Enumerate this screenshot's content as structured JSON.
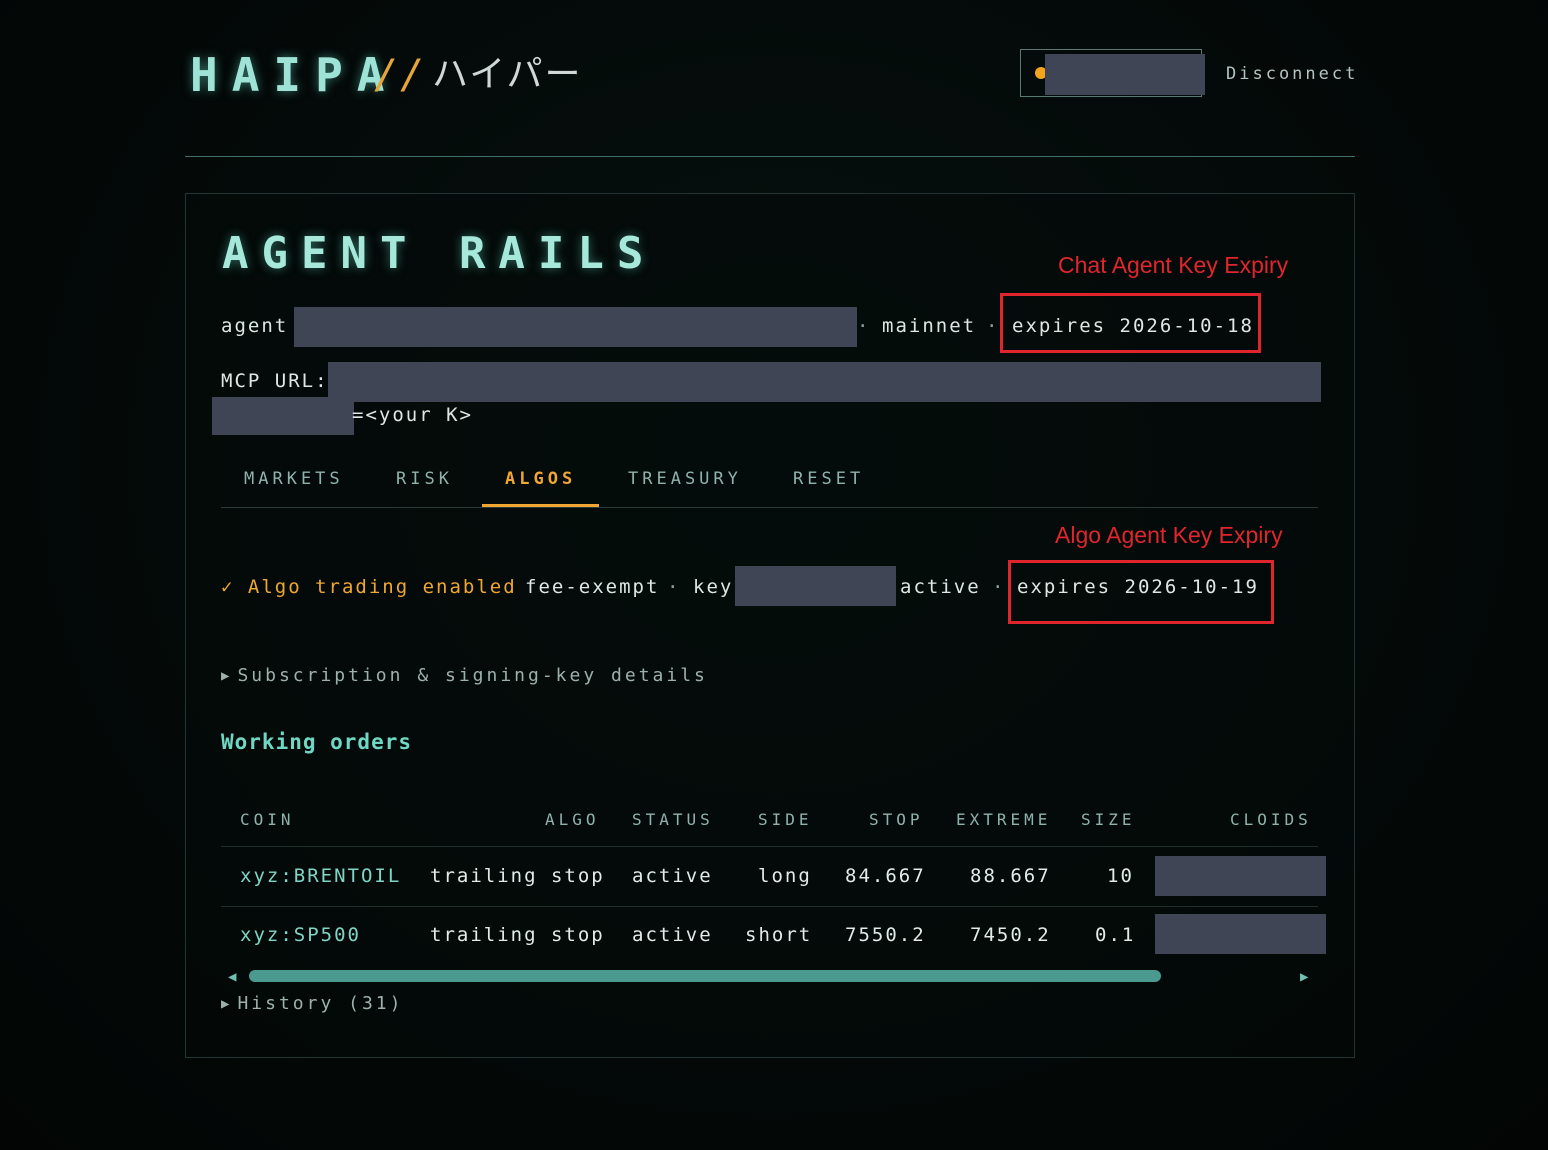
{
  "header": {
    "brand": "HAIPA",
    "separator": "//",
    "brand_jp": "ハイパー",
    "disconnect_label": "Disconnect"
  },
  "panel": {
    "title": "AGENT RAILS",
    "agent_label": "agent",
    "network_sep": "·",
    "network": "mainnet",
    "expiry_sep": "·",
    "agent_expiry": "expires 2026-10-18",
    "mcp_label": "MCP URL:",
    "mcp_suffix": "=<your K>",
    "annotations": {
      "chat": "Chat Agent Key Expiry",
      "algo": "Algo Agent Key Expiry"
    }
  },
  "tabs": [
    {
      "label": "MARKETS"
    },
    {
      "label": "RISK"
    },
    {
      "label": "ALGOS",
      "active": true
    },
    {
      "label": "TREASURY"
    },
    {
      "label": "RESET"
    }
  ],
  "algos": {
    "status": "✓ Algo trading enabled",
    "fee": "fee-exempt",
    "sep1": "·",
    "key_label": "key",
    "key_status": "active",
    "sep2": "·",
    "expiry": "expires 2026-10-19",
    "details_link": "Subscription & signing-key details",
    "working_orders_title": "Working orders",
    "history_link": "History (31)"
  },
  "orders": {
    "columns": [
      "COIN",
      "ALGO",
      "STATUS",
      "SIDE",
      "STOP",
      "EXTREME",
      "SIZE",
      "CLOIDS"
    ],
    "rows": [
      {
        "coin": "xyz:BRENTOIL",
        "algo": "trailing stop",
        "status": "active",
        "side": "long",
        "stop": "84.667",
        "extreme": "88.667",
        "size": "10"
      },
      {
        "coin": "xyz:SP500",
        "algo": "trailing stop",
        "status": "active",
        "side": "short",
        "stop": "7550.2",
        "extreme": "7450.2",
        "size": "0.1"
      }
    ]
  },
  "colors": {
    "accent": "#f0a632",
    "teal": "#6fd8c4",
    "annotation": "#e0262c",
    "redaction": "#3f4554"
  }
}
